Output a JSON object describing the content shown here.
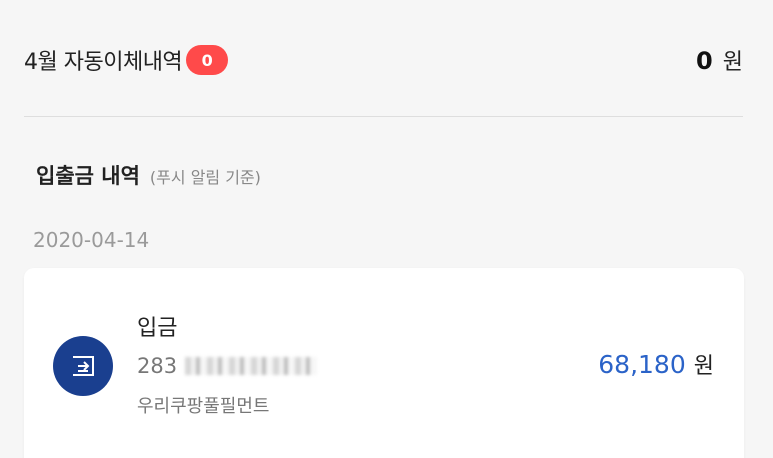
{
  "summary": {
    "title": "4월 자동이체내역",
    "badge_count": "0",
    "amount": "0",
    "unit": "원"
  },
  "section": {
    "title": "입출금 내역",
    "subtitle": "(푸시 알림 기준)"
  },
  "date_group": {
    "date": "2020-04-14"
  },
  "transaction": {
    "type": "입금",
    "account_prefix": "283",
    "memo": "우리쿠팡풀필먼트",
    "amount": "68,180",
    "unit": "원",
    "icon": "deposit-icon"
  },
  "colors": {
    "badge": "#ff4a4a",
    "icon_bg": "#1a3f8f",
    "amount": "#2b63c8",
    "background": "#f6f6f6",
    "card": "#ffffff"
  }
}
